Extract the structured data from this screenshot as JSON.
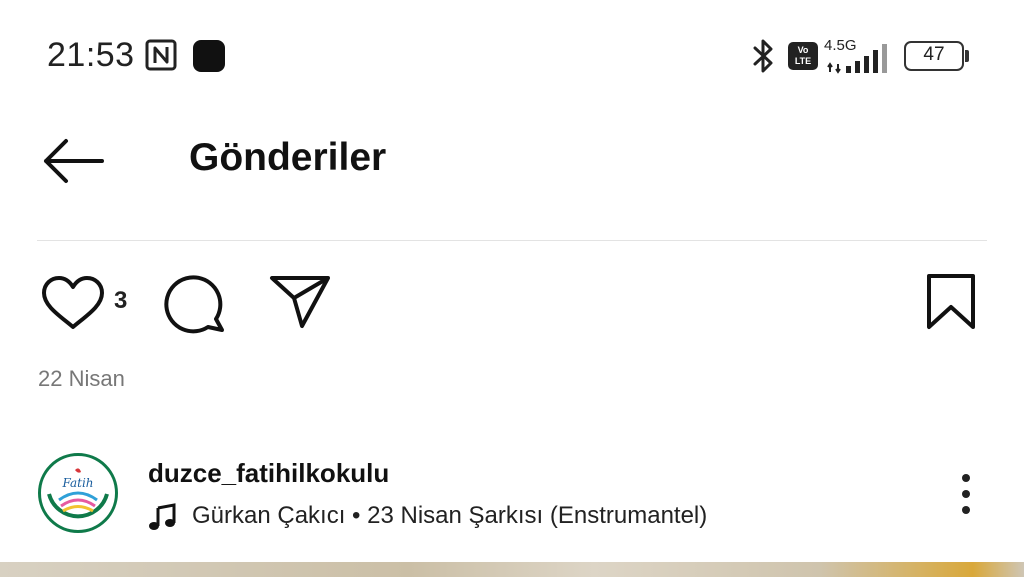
{
  "status_bar": {
    "time": "21:53",
    "network_type": "4.5G",
    "volte_label_top": "Vo",
    "volte_label_bottom": "LTE",
    "battery_level": "47",
    "icons": [
      "nfc-icon",
      "app-notification-icon",
      "bluetooth-icon",
      "volte-icon",
      "signal-icon",
      "battery-icon"
    ]
  },
  "header": {
    "title": "Gönderiler",
    "back_icon": "arrow-left-icon"
  },
  "actions": {
    "like_count": "3",
    "icons": [
      "heart-icon",
      "comment-icon",
      "send-icon",
      "bookmark-icon"
    ]
  },
  "post": {
    "date": "22 Nisan",
    "username": "duzce_fatihilkokulu",
    "music": "Gürkan Çakıcı • 23 Nisan Şarkısı  (Enstrumantel)",
    "avatar_text": "Fatih",
    "colors": {
      "avatar_border": "#0f7a4a"
    }
  }
}
